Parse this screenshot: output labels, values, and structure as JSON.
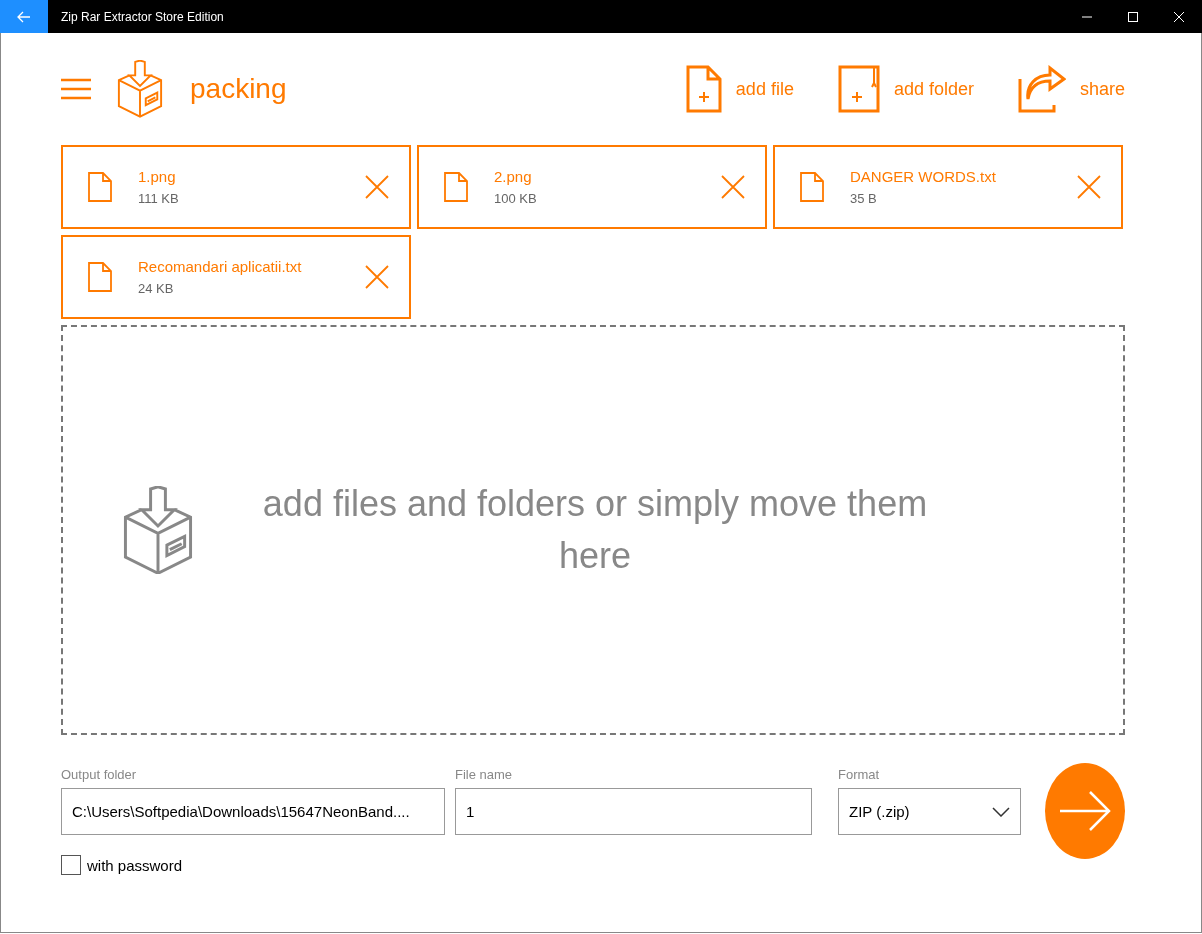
{
  "window": {
    "title": "Zip Rar Extractor Store Edition"
  },
  "header": {
    "title": "packing"
  },
  "actions": [
    {
      "kind": "file",
      "label": "add file"
    },
    {
      "kind": "folder",
      "label": "add folder"
    },
    {
      "kind": "share",
      "label": "share"
    }
  ],
  "files": [
    {
      "name": "1.png",
      "size": "111 KB"
    },
    {
      "name": "2.png",
      "size": "100 KB"
    },
    {
      "name": "DANGER WORDS.txt",
      "size": "35 B"
    },
    {
      "name": "Recomandari aplicatii.txt",
      "size": "24 KB"
    }
  ],
  "drop_zone": {
    "text": "add files and folders or simply move them here"
  },
  "output_folder": {
    "label": "Output folder",
    "value": "C:\\Users\\Softpedia\\Downloads\\15647NeonBand...."
  },
  "file_name": {
    "label": "File name",
    "value": "1"
  },
  "format": {
    "label": "Format",
    "value": "ZIP (.zip)"
  },
  "password": {
    "label": "with password",
    "checked": false
  }
}
